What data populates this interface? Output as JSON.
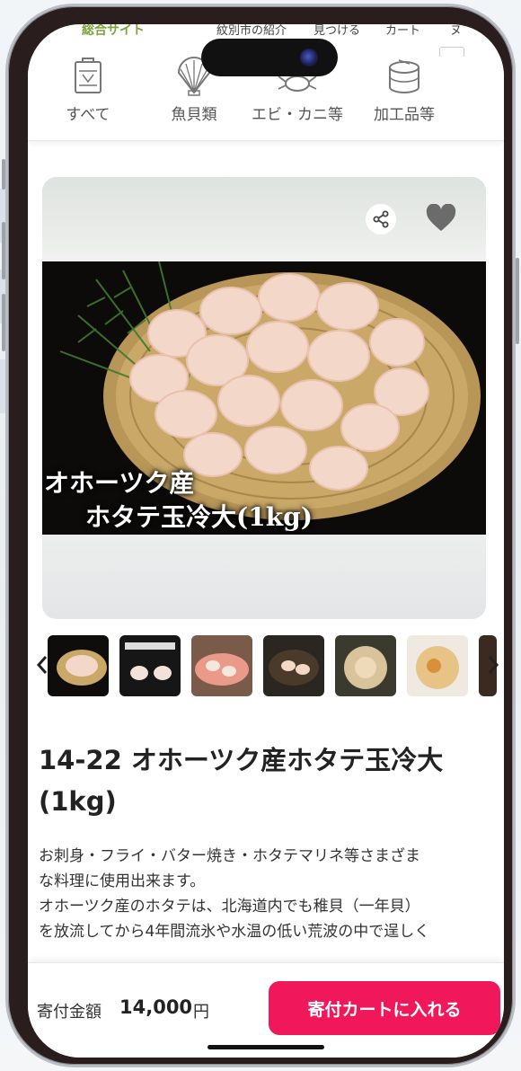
{
  "header": {
    "site_name": "総合サイト",
    "nav": [
      "紋別市の紹介",
      "見つける",
      "カート",
      "ヌ"
    ],
    "categories": [
      {
        "label": "すべて",
        "icon": "document-bag-icon"
      },
      {
        "label": "魚貝類",
        "icon": "scallop-shell-icon"
      },
      {
        "label": "エビ・カニ等",
        "icon": "crab-icon"
      },
      {
        "label": "加工品等",
        "icon": "canned-food-icon"
      }
    ]
  },
  "product": {
    "image_caption_line1": "オホーツク産",
    "image_caption_line2": "ホタテ玉冷大(1kg)",
    "title": "14-22 オホーツク産ホタテ玉冷大(1kg)",
    "description_lines": [
      "お刺身・フライ・バター焼き・ホタテマリネ等さまざま",
      "な料理に使用出来ます。",
      "オホーツク産のホタテは、北海道内でも稚貝（一年貝）",
      "を放流してから4年間流氷や水温の低い荒波の中で逞しく"
    ],
    "thumbnail_count": 7
  },
  "footer": {
    "price_label": "寄付金額",
    "price_value": "14,000",
    "price_unit": "円",
    "cart_button": "寄付カートに入れる"
  },
  "colors": {
    "accent": "#f0185a",
    "site_green": "#7aa33a"
  }
}
